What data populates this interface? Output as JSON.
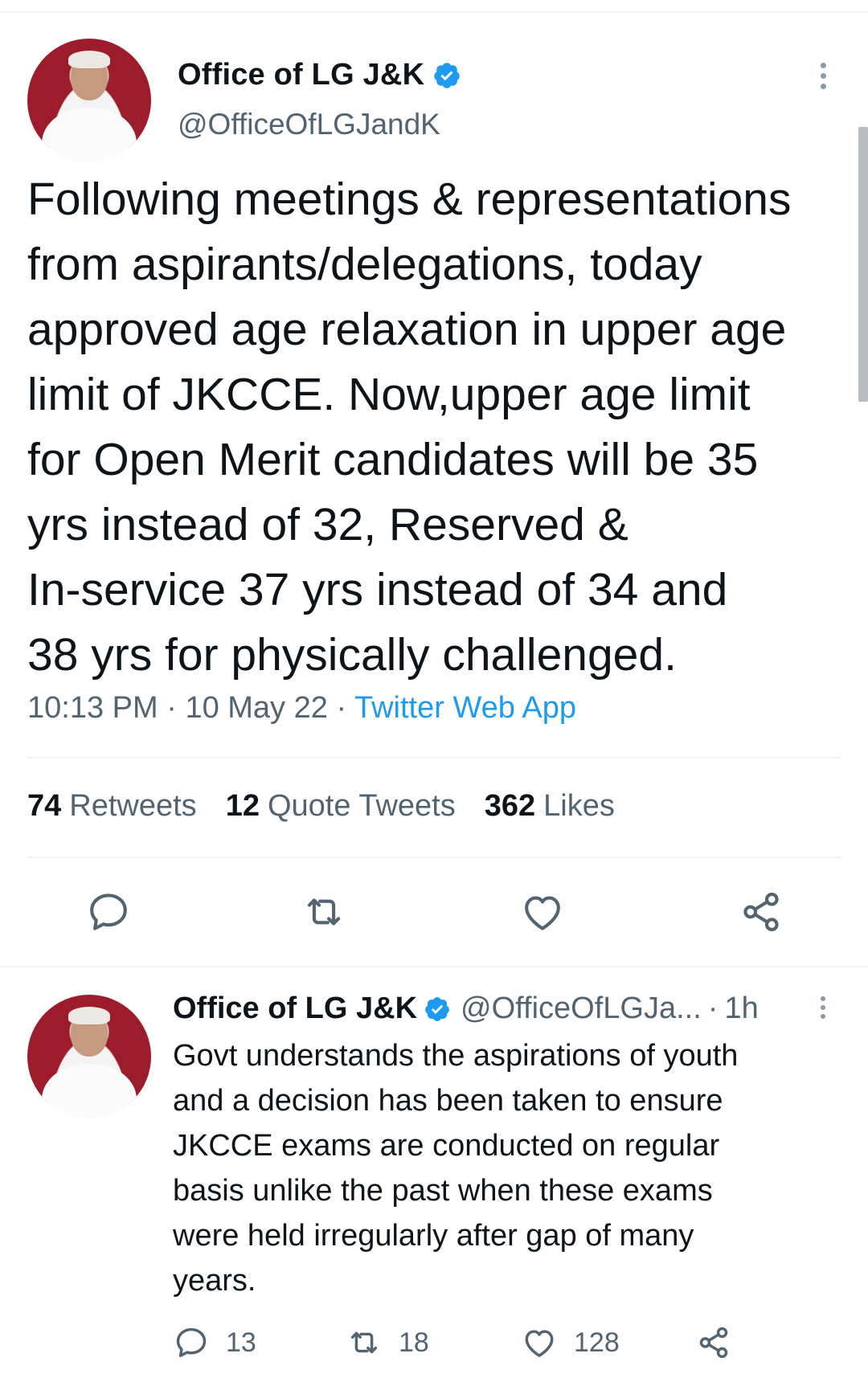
{
  "main_tweet": {
    "display_name": "Office of LG J&K",
    "handle": "@OfficeOfLGJandK",
    "text": "Following meetings & representations\nfrom aspirants/delegations, today\napproved age relaxation in upper age\nlimit of JKCCE. Now,upper age limit\nfor Open Merit candidates will be 35\nyrs instead of 32, Reserved &\nIn-service 37 yrs instead of 34 and\n38 yrs for physically challenged.",
    "time": "10:13 PM",
    "date": "10 May 22",
    "source": "Twitter Web App",
    "stats": {
      "retweets_count": "74",
      "retweets_label": "Retweets",
      "quotes_count": "12",
      "quotes_label": "Quote Tweets",
      "likes_count": "362",
      "likes_label": "Likes"
    },
    "icons": [
      "reply-icon",
      "retweet-icon",
      "like-icon",
      "share-icon"
    ]
  },
  "reply_tweet": {
    "display_name": "Office of LG J&K",
    "handle": "@OfficeOfLGJa...",
    "separator": "·",
    "age": "1h",
    "text": "Govt understands the aspirations of youth\nand a decision has been taken to ensure\nJKCCE exams are conducted on regular\nbasis unlike the past when these exams\nwere held irregularly after gap of many\nyears.",
    "reply_count": "13",
    "retweet_count": "18",
    "like_count": "128"
  },
  "colors": {
    "verified": "#1d9bf0",
    "link": "#1d9bf0",
    "secondary_text": "#536471",
    "avatar_bg": "#9d1c2c"
  }
}
